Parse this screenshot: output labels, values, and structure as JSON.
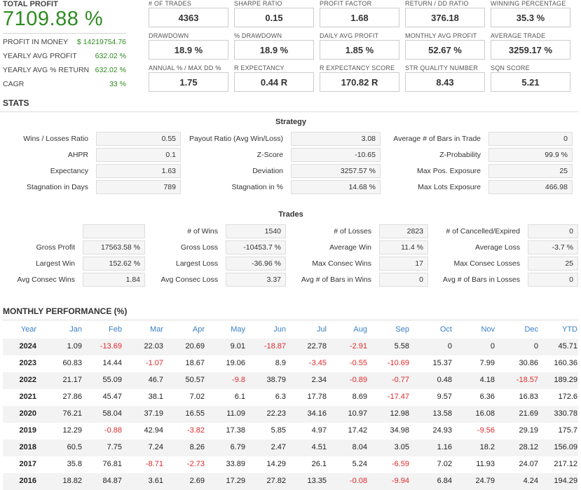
{
  "summary": {
    "total_profit_label": "TOTAL PROFIT",
    "total_profit_value": "7109.88 %",
    "rows": [
      {
        "label": "PROFIT IN MONEY",
        "value": "$ 14219754.76"
      },
      {
        "label": "YEARLY AVG PROFIT",
        "value": "632.02 %"
      },
      {
        "label": "YEARLY AVG % RETURN",
        "value": "632.02 %"
      },
      {
        "label": "CAGR",
        "value": "33 %"
      }
    ]
  },
  "metrics": [
    [
      {
        "label": "# OF TRADES",
        "value": "4363"
      },
      {
        "label": "SHARPE RATIO",
        "value": "0.15"
      },
      {
        "label": "PROFIT FACTOR",
        "value": "1.68"
      },
      {
        "label": "RETURN / DD RATIO",
        "value": "376.18"
      },
      {
        "label": "WINNING PERCENTAGE",
        "value": "35.3 %"
      }
    ],
    [
      {
        "label": "DRAWDOWN",
        "value": "18.9 %"
      },
      {
        "label": "% DRAWDOWN",
        "value": "18.9 %"
      },
      {
        "label": "DAILY AVG PROFIT",
        "value": "1.85 %"
      },
      {
        "label": "MONTHLY AVG PROFIT",
        "value": "52.67 %"
      },
      {
        "label": "AVERAGE TRADE",
        "value": "3259.17 %"
      }
    ],
    [
      {
        "label": "ANNUAL % / MAX DD %",
        "value": "1.75"
      },
      {
        "label": "R EXPECTANCY",
        "value": "0.44 R"
      },
      {
        "label": "R EXPECTANCY SCORE",
        "value": "170.82 R"
      },
      {
        "label": "STR QUALITY NUMBER",
        "value": "8.43"
      },
      {
        "label": "SQN SCORE",
        "value": "5.21"
      }
    ]
  ],
  "stats": {
    "title": "STATS",
    "strategy": {
      "title": "Strategy",
      "rows": [
        [
          {
            "label": "Wins / Losses Ratio",
            "value": "0.55"
          },
          {
            "label": "Payout Ratio (Avg Win/Loss)",
            "value": "3.08"
          },
          {
            "label": "Average # of Bars in Trade",
            "value": "0"
          }
        ],
        [
          {
            "label": "AHPR",
            "value": "0.1"
          },
          {
            "label": "Z-Score",
            "value": "-10.65"
          },
          {
            "label": "Z-Probability",
            "value": "99.9 %"
          }
        ],
        [
          {
            "label": "Expectancy",
            "value": "1.63"
          },
          {
            "label": "Deviation",
            "value": "3257.57 %"
          },
          {
            "label": "Max Pos. Exposure",
            "value": "25"
          }
        ],
        [
          {
            "label": "Stagnation in Days",
            "value": "789"
          },
          {
            "label": "Stagnation in %",
            "value": "14.68 %"
          },
          {
            "label": "Max Lots Exposure",
            "value": "466.98"
          }
        ]
      ]
    },
    "trades": {
      "title": "Trades",
      "rows": [
        [
          {
            "label": "",
            "value": ""
          },
          {
            "label": "# of Wins",
            "value": "1540"
          },
          {
            "label": "# of Losses",
            "value": "2823"
          },
          {
            "label": "# of Cancelled/Expired",
            "value": "0"
          }
        ],
        [
          {
            "label": "Gross Profit",
            "value": "17563.58 %"
          },
          {
            "label": "Gross Loss",
            "value": "-10453.7 %"
          },
          {
            "label": "Average Win",
            "value": "11.4 %"
          },
          {
            "label": "Average Loss",
            "value": "-3.7 %"
          }
        ],
        [
          {
            "label": "Largest Win",
            "value": "152.62 %"
          },
          {
            "label": "Largest Loss",
            "value": "-36.96 %"
          },
          {
            "label": "Max Consec Wins",
            "value": "17"
          },
          {
            "label": "Max Consec Losses",
            "value": "25"
          }
        ],
        [
          {
            "label": "Avg Consec Wins",
            "value": "1.84"
          },
          {
            "label": "Avg Consec Loss",
            "value": "3.37"
          },
          {
            "label": "Avg # of Bars in Wins",
            "value": "0"
          },
          {
            "label": "Avg # of Bars in Losses",
            "value": "0"
          }
        ]
      ]
    }
  },
  "monthly": {
    "title": "MONTHLY PERFORMANCE (%)",
    "headers": [
      "Year",
      "Jan",
      "Feb",
      "Mar",
      "Apr",
      "May",
      "Jun",
      "Jul",
      "Aug",
      "Sep",
      "Oct",
      "Nov",
      "Dec",
      "YTD"
    ],
    "rows": [
      [
        "2024",
        "1.09",
        "-13.69",
        "22.03",
        "20.69",
        "9.01",
        "-18.87",
        "22.78",
        "-2.91",
        "5.58",
        "0",
        "0",
        "0",
        "45.71"
      ],
      [
        "2023",
        "60.83",
        "14.44",
        "-1.07",
        "18.67",
        "19.06",
        "8.9",
        "-3.45",
        "-0.55",
        "-10.69",
        "15.37",
        "7.99",
        "30.86",
        "160.36"
      ],
      [
        "2022",
        "21.17",
        "55.09",
        "46.7",
        "50.57",
        "-9.8",
        "38.79",
        "2.34",
        "-0.89",
        "-0.77",
        "0.48",
        "4.18",
        "-18.57",
        "189.29"
      ],
      [
        "2021",
        "27.86",
        "45.47",
        "38.1",
        "7.02",
        "6.1",
        "6.3",
        "17.78",
        "8.69",
        "-17.47",
        "9.57",
        "6.36",
        "16.83",
        "172.6"
      ],
      [
        "2020",
        "76.21",
        "58.04",
        "37.19",
        "16.55",
        "11.09",
        "22.23",
        "34.16",
        "10.97",
        "12.98",
        "13.58",
        "16.08",
        "21.69",
        "330.78"
      ],
      [
        "2019",
        "12.29",
        "-0.88",
        "42.94",
        "-3.82",
        "17.38",
        "5.85",
        "4.97",
        "17.42",
        "34.98",
        "24.93",
        "-9.56",
        "29.19",
        "175.7"
      ],
      [
        "2018",
        "60.5",
        "7.75",
        "7.24",
        "8.26",
        "6.79",
        "2.47",
        "4.51",
        "8.04",
        "3.05",
        "1.16",
        "18.2",
        "28.12",
        "156.09"
      ],
      [
        "2017",
        "35.8",
        "76.81",
        "-8.71",
        "-2.73",
        "33.89",
        "14.29",
        "26.1",
        "5.24",
        "-6.59",
        "7.02",
        "11.93",
        "24.07",
        "217.12"
      ],
      [
        "2016",
        "18.82",
        "84.87",
        "3.61",
        "2.69",
        "17.29",
        "27.82",
        "13.35",
        "-0.08",
        "-9.94",
        "6.84",
        "24.79",
        "4.24",
        "194.29"
      ]
    ]
  },
  "colors": {
    "profit_green": "#2e8b22",
    "negative_red": "#e0292b",
    "header_blue": "#3a7fc4"
  }
}
